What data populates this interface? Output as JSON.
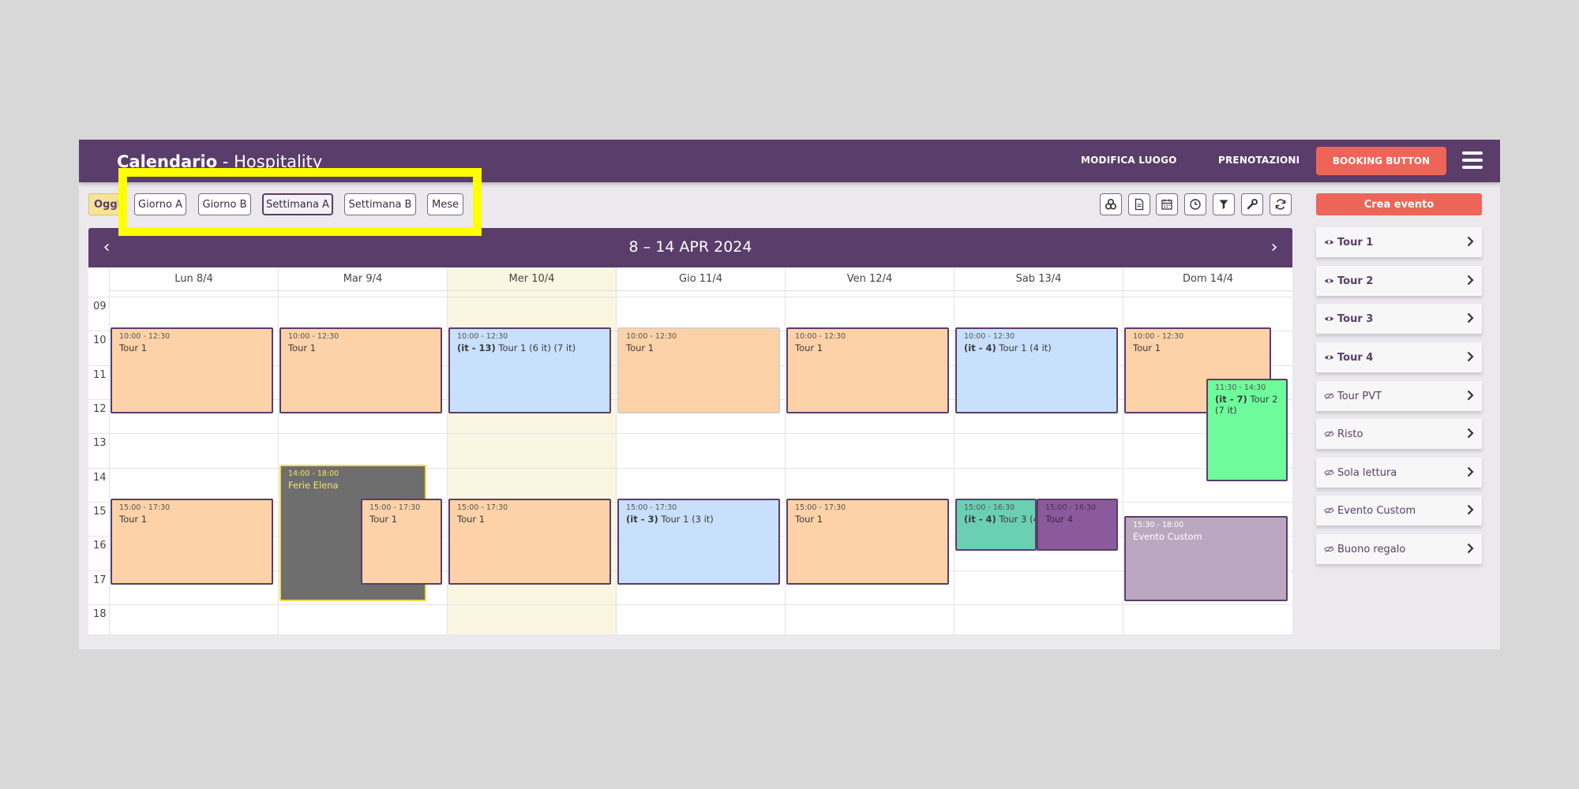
{
  "header": {
    "title_bold": "Calendario",
    "title_rest": " - Hospitality",
    "nav": [
      "MODIFICA LUOGO",
      "PRENOTAZIONI"
    ],
    "booking_button": "BOOKING BUTTON"
  },
  "toolbar": {
    "today": "Oggi",
    "views": [
      "Giorno A",
      "Giorno B",
      "Settimana A",
      "Settimana B",
      "Mese"
    ],
    "active_view": "Settimana A",
    "tools": [
      "layers-icon",
      "document-icon",
      "calendar-icon",
      "clock-icon",
      "filter-icon",
      "wrench-icon",
      "refresh-icon"
    ]
  },
  "calendar": {
    "range": "8 – 14 APR 2024",
    "prev": "‹",
    "next": "›",
    "days": [
      "Lun 8/4",
      "Mar 9/4",
      "Mer 10/4",
      "Gio 11/4",
      "Ven 12/4",
      "Sab 13/4",
      "Dom 14/4"
    ],
    "hours": [
      "09",
      "10",
      "11",
      "12",
      "13",
      "14",
      "15",
      "16",
      "17",
      "18"
    ],
    "events": {
      "e1": {
        "time": "10:00 - 12:30",
        "name": "Tour 1"
      },
      "e2": {
        "time": "10:00 - 12:30",
        "name": "Tour 1"
      },
      "e3": {
        "time": "10:00 - 12:30",
        "prefix": "(it - 13)",
        "name": "Tour 1 (6 it) (7 it)"
      },
      "e4": {
        "time": "10:00 - 12:30",
        "name": "Tour 1"
      },
      "e5": {
        "time": "10:00 - 12:30",
        "name": "Tour 1"
      },
      "e6": {
        "time": "10:00 - 12:30",
        "prefix": "(it - 4)",
        "name": "Tour 1 (4 it)"
      },
      "e7": {
        "time": "10:00 - 12:30",
        "name": "Tour 1"
      },
      "e8": {
        "time": "11:30 - 14:30",
        "prefix": "(it - 7)",
        "name": "Tour 2 (7 it)"
      },
      "e9": {
        "time": "15:00 - 17:30",
        "name": "Tour 1"
      },
      "e10": {
        "time": "14:00 - 18:00",
        "name": "Ferie Elena"
      },
      "e11": {
        "time": "15:00 - 17:30",
        "name": "Tour 1"
      },
      "e12": {
        "time": "15:00 - 17:30",
        "name": "Tour 1"
      },
      "e13": {
        "time": "15:00 - 17:30",
        "prefix": "(it - 3)",
        "name": "Tour 1 (3 it)"
      },
      "e14": {
        "time": "15:00 - 17:30",
        "name": "Tour 1"
      },
      "e15": {
        "time": "15:00 - 16:30",
        "prefix": "(it - 4)",
        "name": "Tour 3 (4"
      },
      "e16": {
        "time": "15:00 - 16:30",
        "name": "Tour 4"
      },
      "e17": {
        "time": "15:30 - 18:00",
        "name": "Evento Custom"
      }
    }
  },
  "sidebar": {
    "create": "Crea evento",
    "categories": [
      {
        "label": "Tour 1",
        "visible": true
      },
      {
        "label": "Tour 2",
        "visible": true
      },
      {
        "label": "Tour 3",
        "visible": true
      },
      {
        "label": "Tour 4",
        "visible": true
      },
      {
        "label": "Tour PVT",
        "visible": false
      },
      {
        "label": "Risto",
        "visible": false
      },
      {
        "label": "Sola lettura",
        "visible": false
      },
      {
        "label": "Evento Custom",
        "visible": false
      },
      {
        "label": "Buono regalo",
        "visible": false
      }
    ]
  },
  "colors": {
    "brand": "#5a3d6a",
    "accent": "#ee6557",
    "highlight": "#ffff00"
  }
}
